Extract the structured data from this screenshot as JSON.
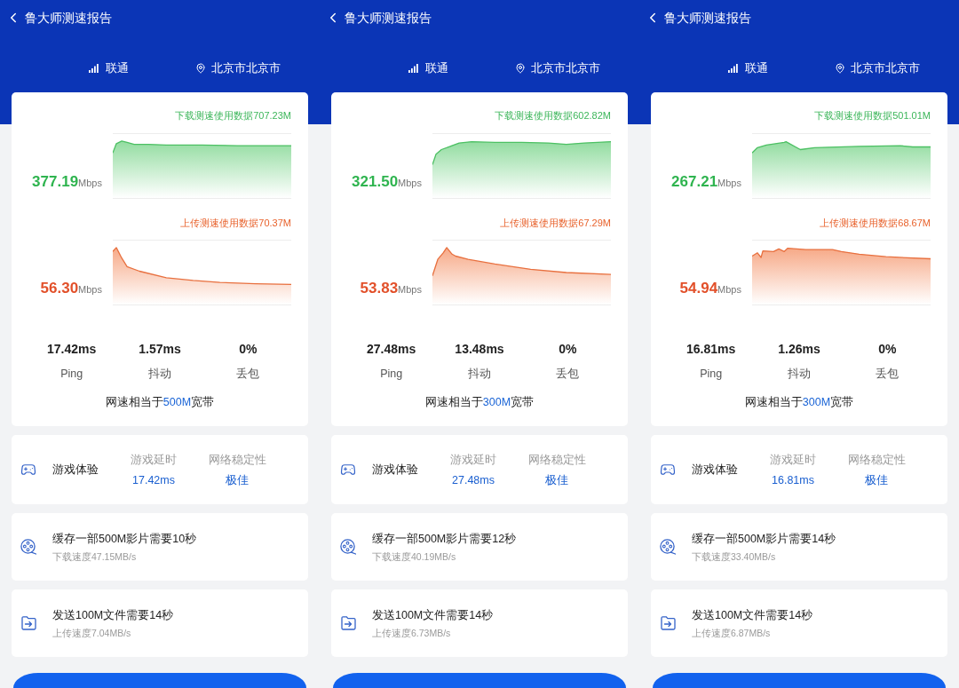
{
  "panels": [
    {
      "header": {
        "title": "鲁大师测速报告",
        "carrier": "联通",
        "location": "北京市北京市"
      },
      "download": {
        "usage_label": "下载测速使用数据707.23M",
        "speed": "377.19",
        "unit": "Mbps"
      },
      "upload": {
        "usage_label": "上传测速使用数据70.37M",
        "speed": "56.30",
        "unit": "Mbps"
      },
      "stats": [
        {
          "value": "17.42ms",
          "label": "Ping"
        },
        {
          "value": "1.57ms",
          "label": "抖动"
        },
        {
          "value": "0%",
          "label": "丢包"
        }
      ],
      "bandwidth": {
        "prefix": "网速相当于",
        "value": "500M",
        "suffix": "宽带"
      },
      "game": {
        "title": "游戏体验",
        "metrics": [
          {
            "label": "游戏延时",
            "value": "17.42ms"
          },
          {
            "label": "网络稳定性",
            "value": "极佳"
          }
        ]
      },
      "tips": [
        {
          "kind": "video",
          "title": "缓存一部500M影片需要10秒",
          "detail": "下载速度47.15MB/s"
        },
        {
          "kind": "file",
          "title": "发送100M文件需要14秒",
          "detail": "上传速度7.04MB/s"
        }
      ]
    },
    {
      "header": {
        "title": "鲁大师测速报告",
        "carrier": "联通",
        "location": "北京市北京市"
      },
      "download": {
        "usage_label": "下载测速使用数据602.82M",
        "speed": "321.50",
        "unit": "Mbps"
      },
      "upload": {
        "usage_label": "上传测速使用数据67.29M",
        "speed": "53.83",
        "unit": "Mbps"
      },
      "stats": [
        {
          "value": "27.48ms",
          "label": "Ping"
        },
        {
          "value": "13.48ms",
          "label": "抖动"
        },
        {
          "value": "0%",
          "label": "丢包"
        }
      ],
      "bandwidth": {
        "prefix": "网速相当于",
        "value": "300M",
        "suffix": "宽带"
      },
      "game": {
        "title": "游戏体验",
        "metrics": [
          {
            "label": "游戏延时",
            "value": "27.48ms"
          },
          {
            "label": "网络稳定性",
            "value": "极佳"
          }
        ]
      },
      "tips": [
        {
          "kind": "video",
          "title": "缓存一部500M影片需要12秒",
          "detail": "下载速度40.19MB/s"
        },
        {
          "kind": "file",
          "title": "发送100M文件需要14秒",
          "detail": "上传速度6.73MB/s"
        }
      ]
    },
    {
      "header": {
        "title": "鲁大师测速报告",
        "carrier": "联通",
        "location": "北京市北京市"
      },
      "download": {
        "usage_label": "下载测速使用数据501.01M",
        "speed": "267.21",
        "unit": "Mbps"
      },
      "upload": {
        "usage_label": "上传测速使用数据68.67M",
        "speed": "54.94",
        "unit": "Mbps"
      },
      "stats": [
        {
          "value": "16.81ms",
          "label": "Ping"
        },
        {
          "value": "1.26ms",
          "label": "抖动"
        },
        {
          "value": "0%",
          "label": "丢包"
        }
      ],
      "bandwidth": {
        "prefix": "网速相当于",
        "value": "300M",
        "suffix": "宽带"
      },
      "game": {
        "title": "游戏体验",
        "metrics": [
          {
            "label": "游戏延时",
            "value": "16.81ms"
          },
          {
            "label": "网络稳定性",
            "value": "极佳"
          }
        ]
      },
      "tips": [
        {
          "kind": "video",
          "title": "缓存一部500M影片需要14秒",
          "detail": "下载速度33.40MB/s"
        },
        {
          "kind": "file",
          "title": "发送100M文件需要14秒",
          "detail": "上传速度6.87MB/s"
        }
      ]
    }
  ]
}
